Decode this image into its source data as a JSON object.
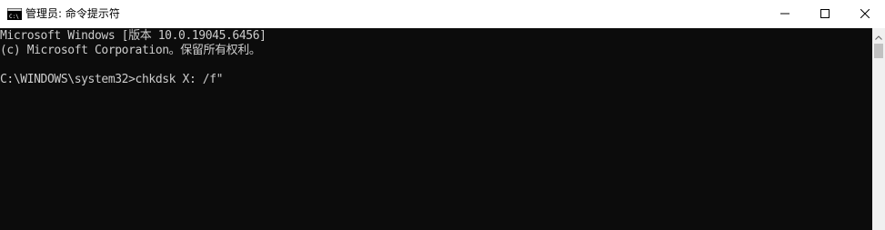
{
  "window": {
    "title": "管理员: 命令提示符",
    "icon": "cmd-icon"
  },
  "caption_buttons": {
    "minimize": "minimize-icon",
    "maximize": "maximize-icon",
    "close": "close-icon"
  },
  "console": {
    "lines": [
      "Microsoft Windows [版本 10.0.19045.6456]",
      "(c) Microsoft Corporation。保留所有权利。",
      "",
      "C:\\WINDOWS\\system32>chkdsk X: /f\""
    ],
    "text_color": "#cccccc",
    "background": "#0c0c0c"
  }
}
